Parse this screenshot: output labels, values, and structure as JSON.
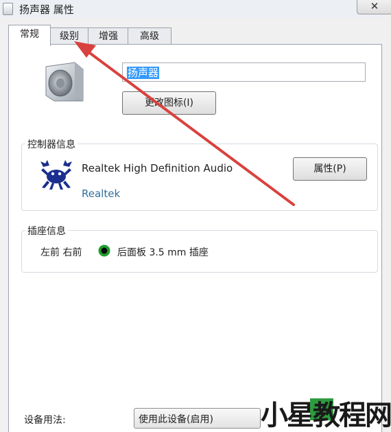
{
  "window": {
    "title": "扬声器 属性",
    "close_glyph": "✕"
  },
  "tabs": [
    {
      "label": "常规",
      "active": true
    },
    {
      "label": "级别",
      "active": false
    },
    {
      "label": "增强",
      "active": false
    },
    {
      "label": "高级",
      "active": false
    }
  ],
  "general": {
    "device_name_value": "扬声器",
    "change_icon_label": "更改图标(I)",
    "controller_group": {
      "title": "控制器信息",
      "device": "Realtek High Definition Audio",
      "manufacturer": "Realtek",
      "properties_label": "属性(P)",
      "logo_icon": "realtek-crab-logo"
    },
    "jack_group": {
      "title": "插座信息",
      "channels": "左前 右前",
      "jack_description": "后面板 3.5 mm 插座",
      "jack_color": "#1f9e2c"
    },
    "usage": {
      "label": "设备用法:",
      "selected": "使用此设备(启用)"
    }
  },
  "annotation": {
    "arrow_color": "#d8423e"
  },
  "watermark": {
    "text": "小星教程网"
  }
}
